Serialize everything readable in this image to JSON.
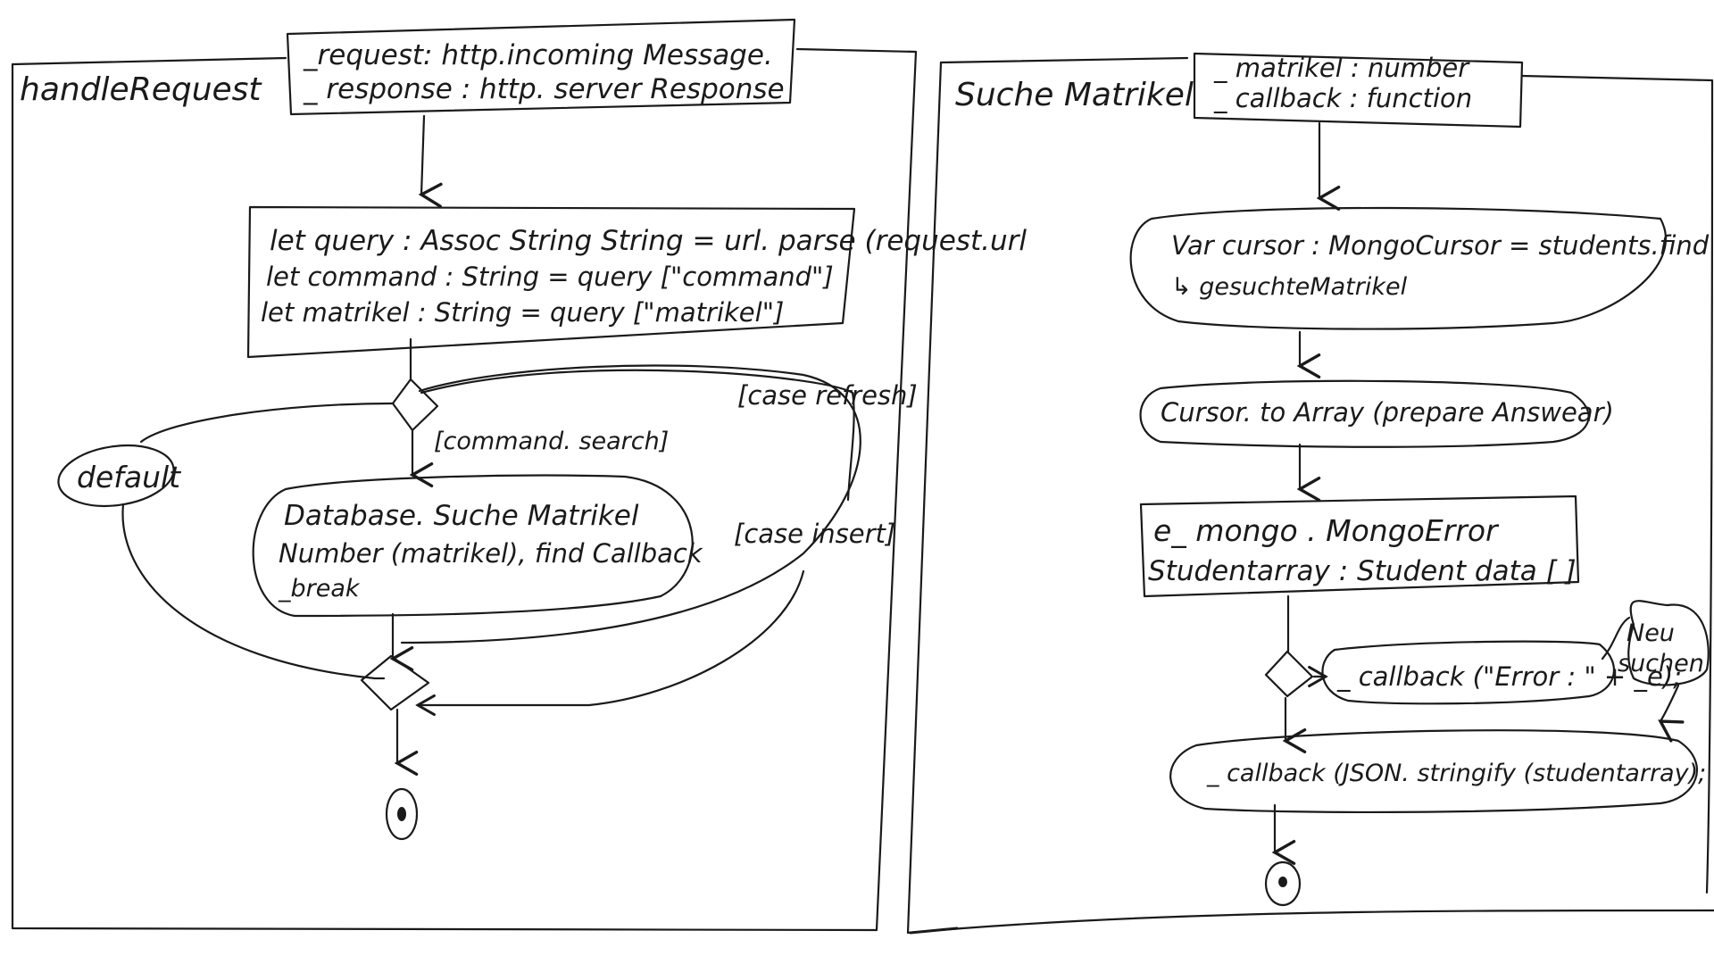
{
  "left": {
    "title": "handleRequest",
    "params": [
      "_request: http.incoming Message.",
      "_ response : http. server Response"
    ],
    "init": [
      "let query : Assoc String String = url. parse (request.url",
      "let command : String = query [\"command\"]",
      "let matrikel : String = query [\"matrikel\"]"
    ],
    "guards": {
      "search": "[command. search]",
      "refresh": "[case refresh]",
      "insert": "[case insert]",
      "default": "default"
    },
    "search_action": [
      "Database. Suche Matrikel",
      "Number (matrikel), find Callback",
      "_break"
    ]
  },
  "right": {
    "title": "Suche Matrikel",
    "params": [
      "_ matrikel : number",
      "_ callback : function"
    ],
    "cursor": [
      "Var cursor : MongoCursor = students.find",
      "↳ gesuchteMatrikel"
    ],
    "to_array": "Cursor. to Array (prepare Answear)",
    "decl": [
      "e_ mongo . MongoError",
      "Studentarray : Student data [ ]"
    ],
    "error_callback": "_ callback (\"Error : \" + _e);",
    "new_search": [
      "Neu",
      "suchen"
    ],
    "success_callback": "_ callback (JSON. stringify (studentarray);"
  }
}
